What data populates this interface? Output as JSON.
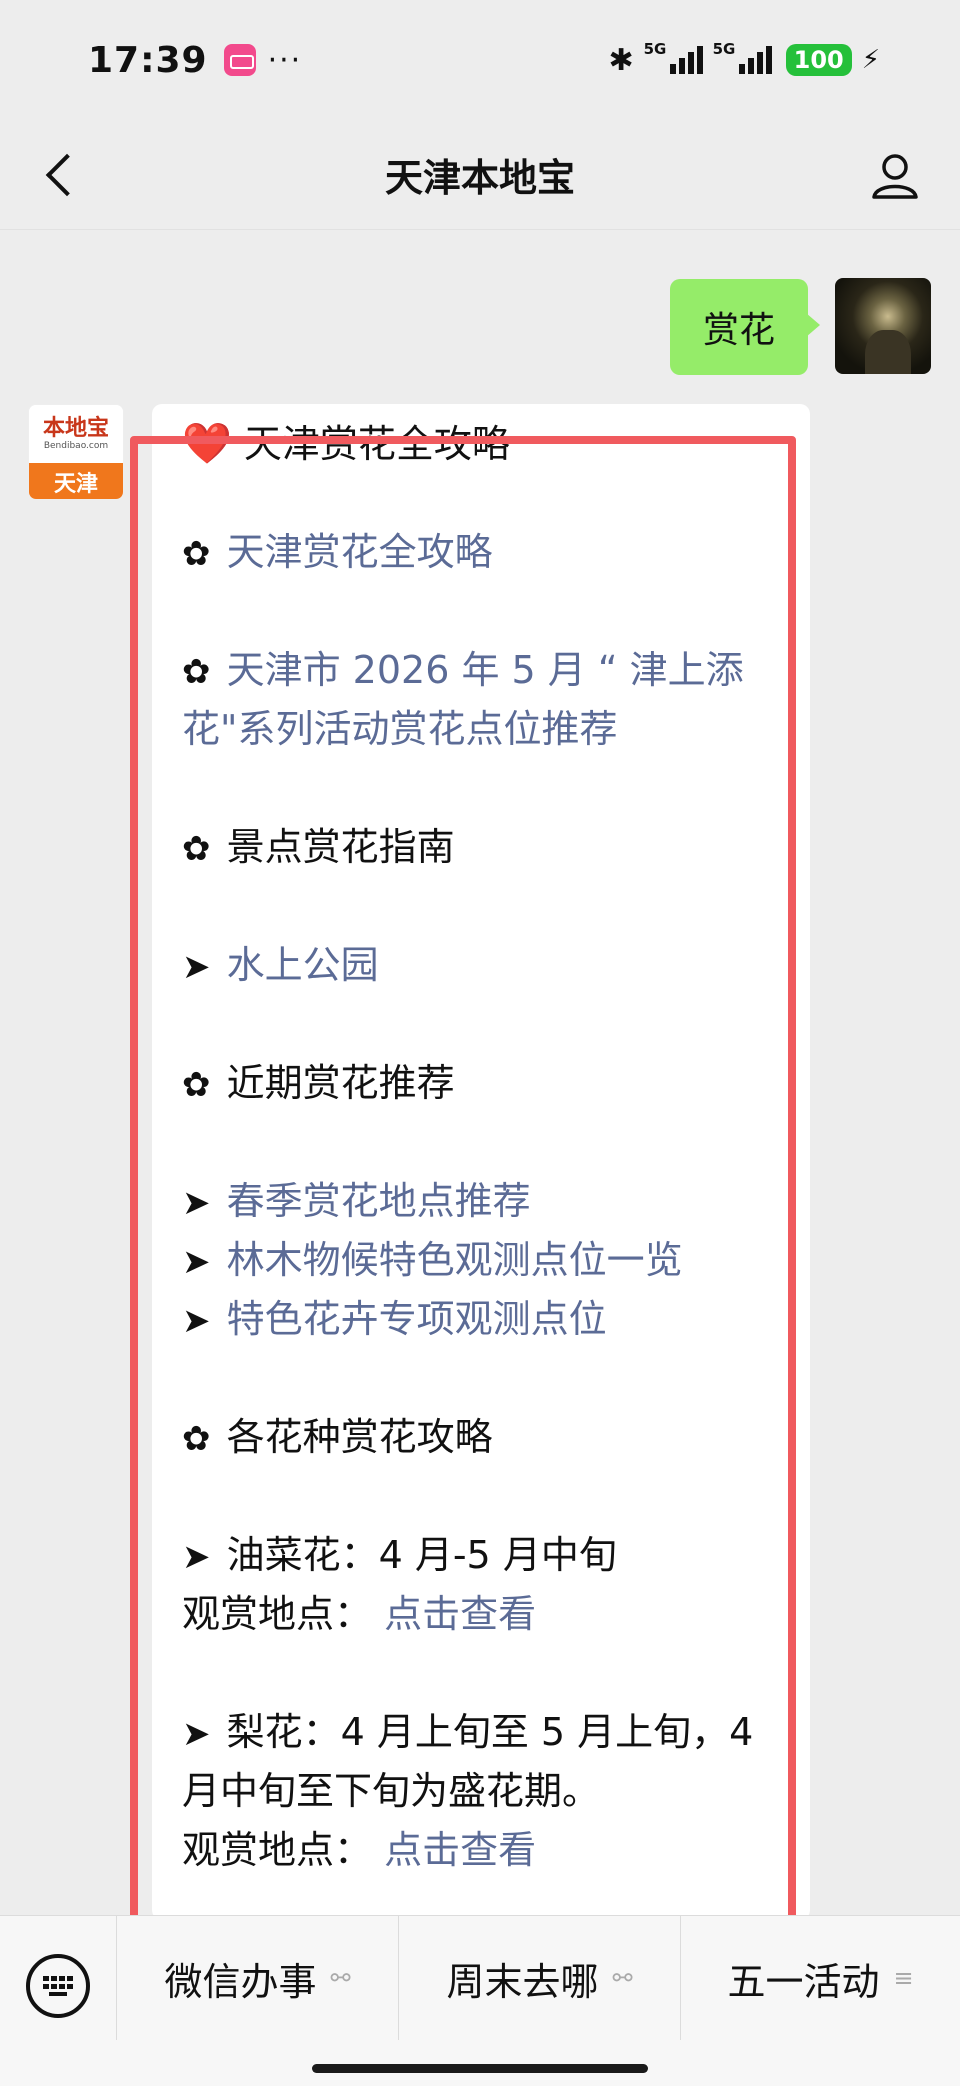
{
  "status_bar": {
    "time": "17:39",
    "dots": "···",
    "network_1": "5G",
    "network_2": "5G",
    "battery": "100"
  },
  "nav": {
    "title": "天津本地宝"
  },
  "user_message": {
    "text": "赏花"
  },
  "bot_avatar": {
    "logo_text": "本地宝",
    "logo_sub": "Bendibao.com",
    "city": "天津"
  },
  "reply": {
    "lines": [
      {
        "prefix": "❤️",
        "text": "天津赏花全攻略",
        "link": false
      },
      {
        "prefix": "✿",
        "text": "天津赏花全攻略",
        "link": true
      },
      {
        "prefix": "✿",
        "text": "天津市 2026 年 5 月 “ 津上添",
        "link": true
      },
      {
        "prefix": "",
        "text": "花\"系列活动赏花点位推荐",
        "link": true
      },
      {
        "prefix": "✿",
        "text": "景点赏花指南",
        "link": false
      },
      {
        "prefix": "➤",
        "text": "水上公园",
        "link": true
      },
      {
        "prefix": "✿",
        "text": "近期赏花推荐",
        "link": false
      },
      {
        "prefix": "➤",
        "text": "春季赏花地点推荐",
        "link": true
      },
      {
        "prefix": "➤",
        "text": "林木物候特色观测点位一览",
        "link": true
      },
      {
        "prefix": "➤",
        "text": "特色花卉专项观测点位",
        "link": true
      },
      {
        "prefix": "✿",
        "text": "各花种赏花攻略",
        "link": false
      },
      {
        "prefix": "➤",
        "text": "油菜花：4 月-5 月中旬",
        "link": false
      },
      {
        "prefix": "",
        "label": "观赏地点：",
        "text": "点击查看",
        "link": true
      },
      {
        "prefix": "➤",
        "text": "梨花：4 月上旬至 5 月上旬，4",
        "link": false
      },
      {
        "prefix": "",
        "text": "月中旬至下旬为盛花期。",
        "link": false
      },
      {
        "prefix": "",
        "label": "观赏地点：",
        "text": "点击查看",
        "link": true
      }
    ]
  },
  "bottom_menu": {
    "items": [
      {
        "label": "微信办事",
        "icon": "link-icon"
      },
      {
        "label": "周末去哪",
        "icon": "link-icon"
      },
      {
        "label": "五一活动",
        "icon": "menu-lines-icon"
      }
    ]
  },
  "colors": {
    "outgoing_bubble": "#95ec69",
    "link": "#5b6b96",
    "highlight": "#f05a5e",
    "battery": "#25c03a"
  }
}
